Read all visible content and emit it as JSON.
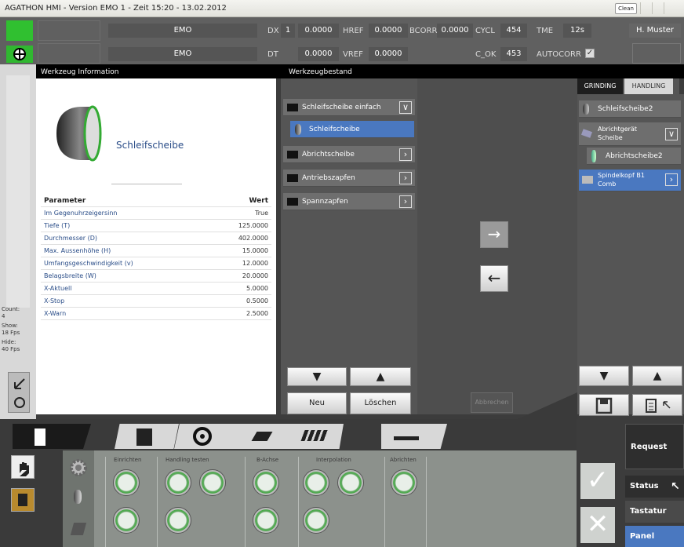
{
  "titlebar": {
    "title": "AGATHON HMI - Version EMO 1 - Zeit 15:20 - 13.02.2012",
    "clean": "Clean"
  },
  "header": {
    "row1": {
      "machine": "EMO",
      "dx_label": "DX",
      "dx_index": "1",
      "dx_value": "0.0000",
      "href_label": "HREF",
      "href_value": "0.0000",
      "bcorr_label": "BCORR",
      "bcorr_value": "0.0000",
      "cycl_label": "CYCL",
      "cycl_value": "454",
      "tme_label": "TME",
      "tme_value": "12s",
      "user": "H. Muster"
    },
    "row2": {
      "machine": "EMO",
      "dt_label": "DT",
      "dt_value": "0.0000",
      "vref_label": "VREF",
      "vref_value": "0.0000",
      "cok_label": "C_OK",
      "cok_value": "453",
      "autocorr_label": "AUTOCORR"
    }
  },
  "sections": {
    "werkzeug_info": "Werkzeug Information",
    "werkzeugbestand": "Werkzeugbestand"
  },
  "right_tabs": {
    "grinding": "GRINDING",
    "handling": "HANDLING"
  },
  "tool_name": "Schleifscheibe",
  "parameters": {
    "header": {
      "name": "Parameter",
      "value": "Wert"
    },
    "rows": [
      {
        "name": "Im Gegenuhrzeigersinn",
        "value": "True"
      },
      {
        "name": "Tiefe (T)",
        "value": "125.0000"
      },
      {
        "name": "Durchmesser (D)",
        "value": "402.0000"
      },
      {
        "name": "Max. Aussenhöhe (H)",
        "value": "15.0000"
      },
      {
        "name": "Umfangsgeschwindigkeit (v)",
        "value": "12.0000"
      },
      {
        "name": "Belagsbreite (W)",
        "value": "20.0000"
      },
      {
        "name": "X-Aktuell",
        "value": "5.0000"
      },
      {
        "name": "X-Stop",
        "value": "0.5000"
      },
      {
        "name": "X-Warn",
        "value": "2.5000"
      }
    ]
  },
  "bestand": {
    "items": [
      {
        "label": "Schleifscheibe einfach",
        "chev": "∨"
      },
      {
        "label": "Schleifscheibe"
      },
      {
        "label": "Abrichtscheibe",
        "chev": "›"
      },
      {
        "label": "Antriebszapfen",
        "chev": "›"
      },
      {
        "label": "Spannzapfen",
        "chev": "›"
      }
    ],
    "neu": "Neu",
    "loeschen": "Löschen",
    "abbrechen": "Abbrechen"
  },
  "grinding": {
    "items": [
      {
        "label": "Schleifscheibe2"
      },
      {
        "label": "Abrichtgerät Scheibe",
        "chev": "∨"
      },
      {
        "label": "Abrichtscheibe2"
      },
      {
        "label": "Spindelkopf B1 Comb",
        "chev": "›"
      }
    ]
  },
  "left_stats": {
    "count_label": "Count:",
    "count": "4",
    "show_label": "Show:",
    "show": "18 Fps",
    "hide_label": "Hide:",
    "hide": "40 Fps"
  },
  "groups": [
    "Einrichten",
    "Handling testen",
    "B-Achse",
    "Interpolation",
    "Abrichten"
  ],
  "right_panel": {
    "request": "Request",
    "status": "Status",
    "tastatur": "Tastatur",
    "panel": "Panel"
  }
}
